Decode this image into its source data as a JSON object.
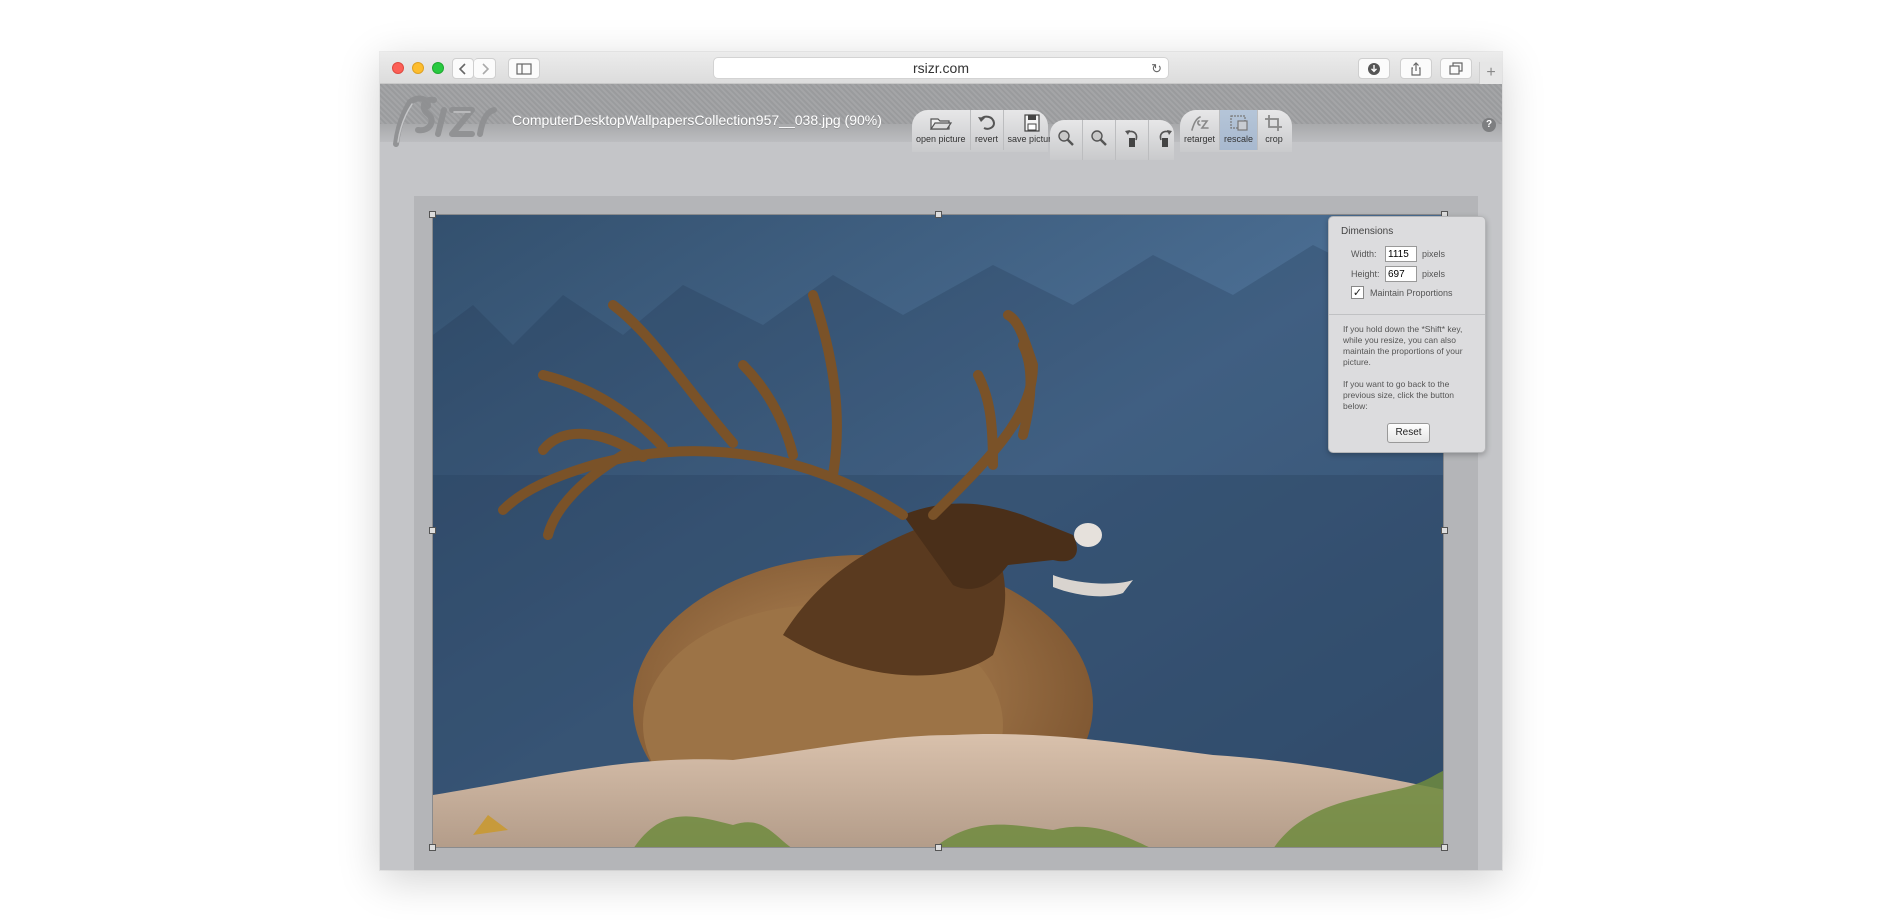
{
  "browser": {
    "url": "rsizr.com",
    "new_tab": "+"
  },
  "app": {
    "filename": "ComputerDesktopWallpapersCollection957__038.jpg (90%)",
    "help": "?",
    "file_tools": [
      {
        "label": "open picture",
        "icon": "open-folder-icon"
      },
      {
        "label": "revert",
        "icon": "revert-icon"
      },
      {
        "label": "save picture",
        "icon": "save-icon"
      }
    ],
    "view_tools": [
      {
        "icon": "zoom-in-icon"
      },
      {
        "icon": "zoom-out-icon"
      },
      {
        "icon": "rotate-left-icon"
      },
      {
        "icon": "rotate-right-icon"
      }
    ],
    "mode_tools": [
      {
        "label": "retarget",
        "icon": "retarget-icon",
        "active": false
      },
      {
        "label": "rescale",
        "icon": "rescale-icon",
        "active": true
      },
      {
        "label": "crop",
        "icon": "crop-icon",
        "active": false
      }
    ]
  },
  "dimensions": {
    "title": "Dimensions",
    "width_label": "Width:",
    "width_value": "1115",
    "height_label": "Height:",
    "height_value": "697",
    "unit": "pixels",
    "maintain_label": "Maintain Proportions",
    "maintain_checked": true,
    "check_glyph": "✓",
    "note_shift": "If you hold down the *Shift* key, while you resize, you can also maintain the proportions of your picture.",
    "note_reset": "If you want to go back to the previous size, click the button below:",
    "reset_label": "Reset"
  }
}
